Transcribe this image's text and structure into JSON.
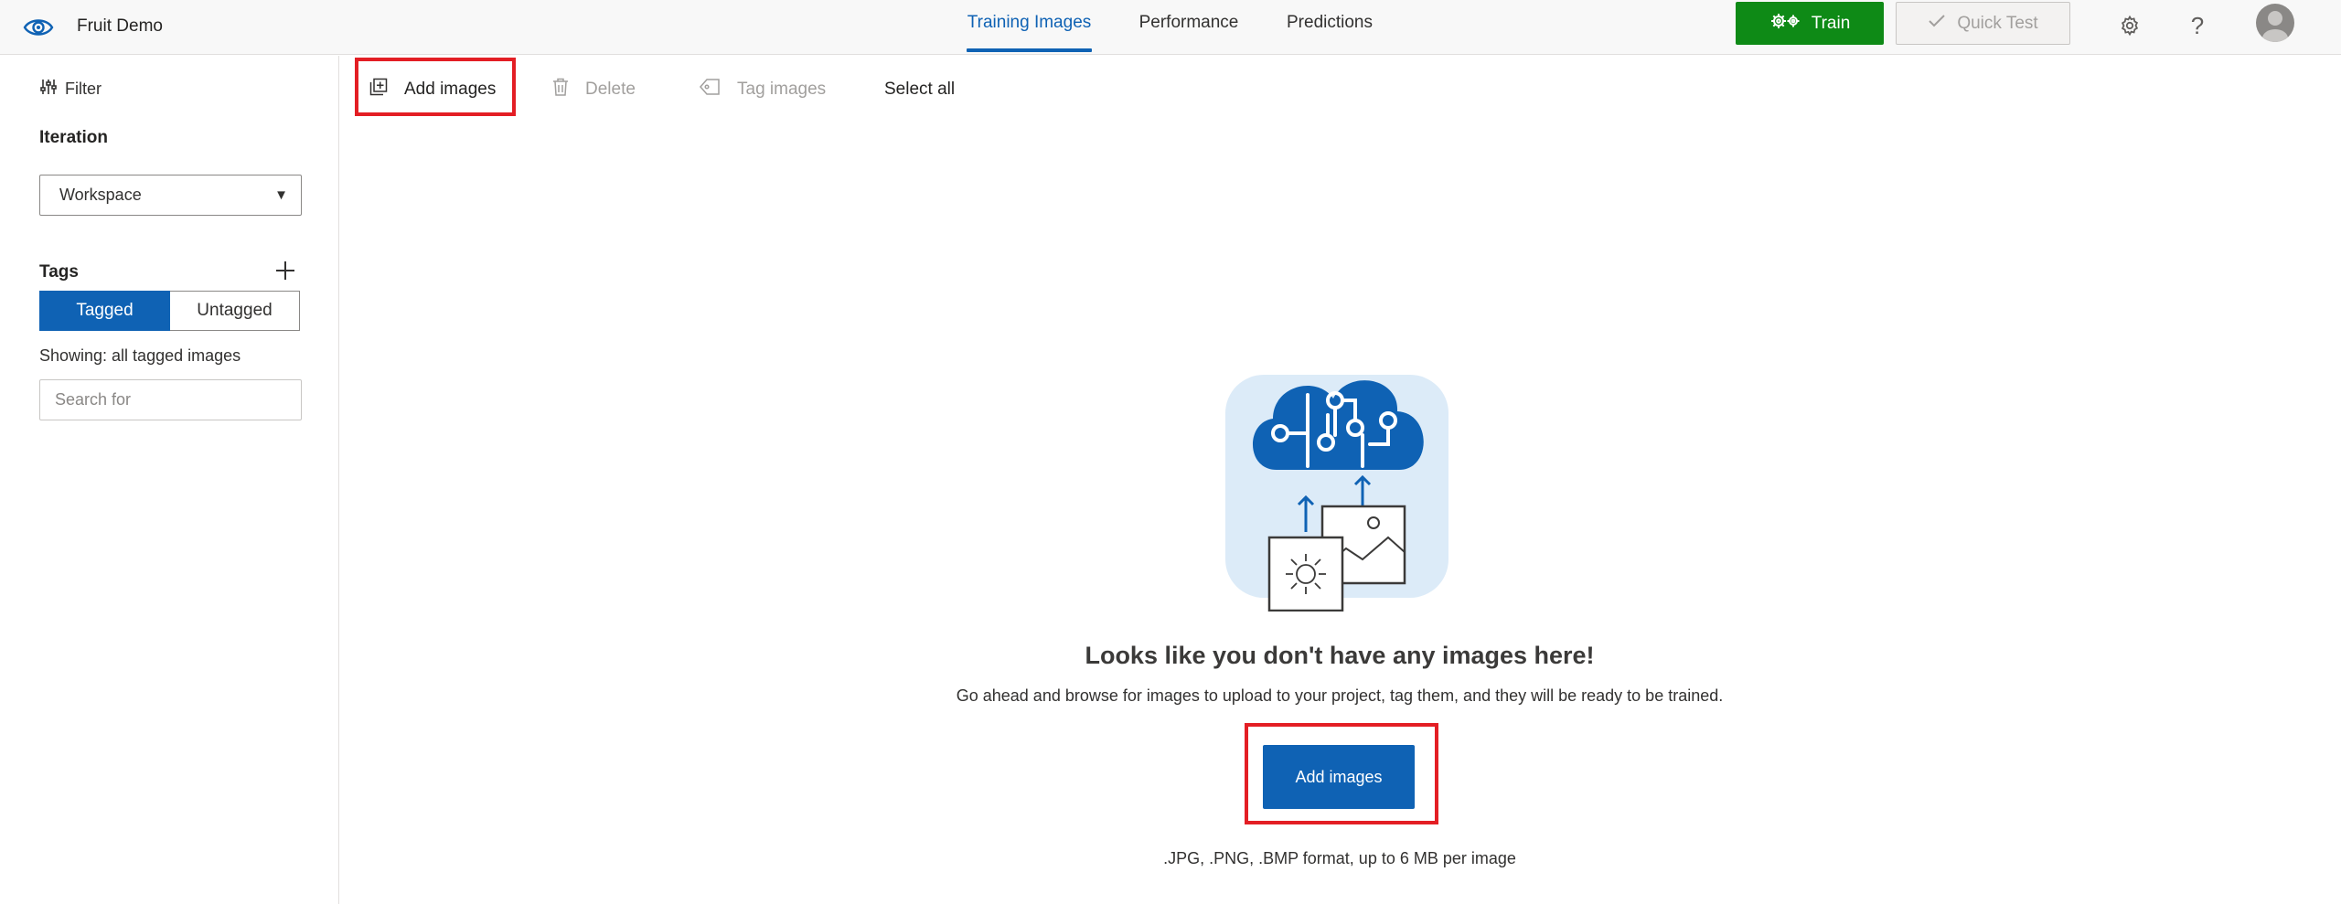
{
  "app": {
    "title": "Fruit Demo"
  },
  "nav": {
    "tabs": [
      {
        "label": "Training Images",
        "active": true
      },
      {
        "label": "Performance",
        "active": false
      },
      {
        "label": "Predictions",
        "active": false
      }
    ]
  },
  "header": {
    "train_label": "Train",
    "quicktest_label": "Quick Test",
    "help_glyph": "?",
    "icons": [
      "eye-logo-icon",
      "gears-icon",
      "check-icon",
      "gear-icon",
      "help-icon",
      "user-avatar-icon"
    ]
  },
  "sidebar": {
    "filter_label": "Filter",
    "iteration_heading": "Iteration",
    "iteration_value": "Workspace",
    "tags_heading": "Tags",
    "tagged_label": "Tagged",
    "untagged_label": "Untagged",
    "showing_text": "Showing: all tagged images",
    "search_placeholder": "Search for"
  },
  "toolbar": {
    "add_images_label": "Add images",
    "delete_label": "Delete",
    "tag_images_label": "Tag images",
    "select_all_label": "Select all"
  },
  "empty_state": {
    "title": "Looks like you don't have any images here!",
    "description": "Go ahead and browse for images to upload to your project, tag them, and they will be ready to be trained.",
    "button_label": "Add images",
    "formats_note": ".JPG, .PNG, .BMP format, up to 6 MB per image"
  },
  "colors": {
    "accent": "#0f62b4",
    "train_green": "#0e8a16",
    "highlight_red": "#e31e24"
  }
}
